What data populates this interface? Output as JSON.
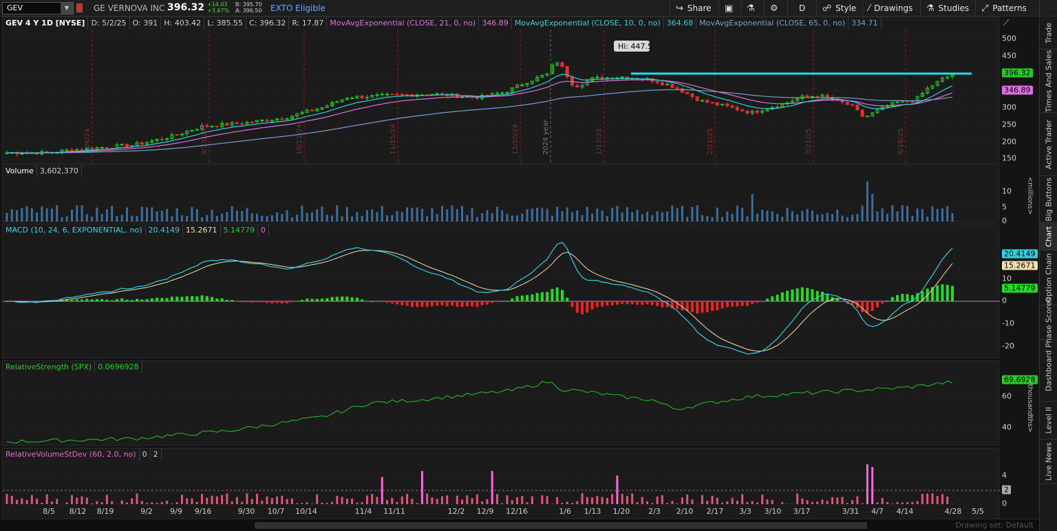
{
  "toolbar": {
    "symbol": "GEV",
    "company": "GE VERNOVA INC",
    "last": "396.32",
    "change": "+14.03",
    "change_pct": "+3.67%",
    "bid": "B: 395.70",
    "ask": "A: 396.50",
    "exto": "EXTO Eligible",
    "share": "Share",
    "period": "D",
    "style": "Style",
    "drawings": "Drawings",
    "studies": "Studies",
    "patterns": "Patterns"
  },
  "price_header": {
    "title": "GEV 4 Y 1D [NYSE]",
    "date": "D: 5/2/25",
    "open": "O: 391",
    "high": "H: 403.42",
    "low": "L: 385.55",
    "close": "C: 396.32",
    "range": "R: 17.87",
    "ema21_label": "MovAvgExponential (CLOSE, 21, 0, no)",
    "ema21_value": "346.89",
    "ema10_label": "MovAvgExponential (CLOSE, 10, 0, no)",
    "ema10_value": "364.68",
    "ema65_label": "MovAvgExponential (CLOSE, 65, 0, no)",
    "ema65_value": "334.71"
  },
  "price_axis": {
    "ticks": [
      "500",
      "450",
      "400",
      "350",
      "300",
      "250",
      "200",
      "150"
    ],
    "last_tag": "396.32",
    "ema_tag": "346.89",
    "hi_label": "Hi: 447.5"
  },
  "vertical_markers": [
    "7/26/24",
    "8/23/24",
    "10/11/24",
    "11/15/24",
    "12/20/24",
    "2024 year",
    "1/17/25",
    "2/21/25",
    "3/21/25",
    "4/18/25"
  ],
  "volume": {
    "label": "Volume",
    "value": "3,602,370",
    "ticks": [
      "10",
      "5",
      "0"
    ],
    "unit": "<millions>"
  },
  "macd": {
    "label": "MACD (10, 24, 6, EXPONENTIAL, no)",
    "v1": "20.4149",
    "v2": "15.2671",
    "v3": "5.14779",
    "v4": "0",
    "ticks": [
      "10",
      "0",
      "-10",
      "-20"
    ],
    "tag1": "20.4149",
    "tag2": "15.2671",
    "tag3": "5.14779"
  },
  "rs": {
    "label": "RelativeStrength (SPX)",
    "value": "0.0696928",
    "ticks": [
      "60",
      "40"
    ],
    "tag": "69.6928",
    "unit": "<thousandths>"
  },
  "rvs": {
    "label": "RelativeVolumeStDev (60, 2.0, no)",
    "v1": "0",
    "v2": "2",
    "ticks": [
      "4",
      "0"
    ],
    "tag": "2"
  },
  "xaxis": [
    "8/5",
    "8/12",
    "8/19",
    "9/2",
    "9/9",
    "9/16",
    "9/30",
    "10/7",
    "10/14",
    "11/4",
    "11/11",
    "12/2",
    "12/9",
    "12/16",
    "1/6",
    "1/13",
    "1/20",
    "2/3",
    "2/10",
    "2/17",
    "3/3",
    "3/10",
    "3/17",
    "3/31",
    "4/7",
    "4/14",
    "4/28",
    "5/5"
  ],
  "status": {
    "drawing_set": "Drawing set: Default"
  },
  "sidetabs": [
    "Trade",
    "Times And Sales",
    "Active Trader",
    "Big Buttons",
    "Chart",
    "Option Chain",
    "Phase Scores",
    "Dashboard",
    "Level II",
    "Live News"
  ],
  "colors": {
    "up": "#22cc22",
    "down": "#e03030",
    "ema10": "#2fd0e0",
    "ema21": "#e070e0",
    "ema65": "#7aa0d0",
    "resistance": "#22e0f0",
    "volume": "#3c6e9e",
    "rs": "#22aa22",
    "rvs": "#ee66cc"
  }
}
